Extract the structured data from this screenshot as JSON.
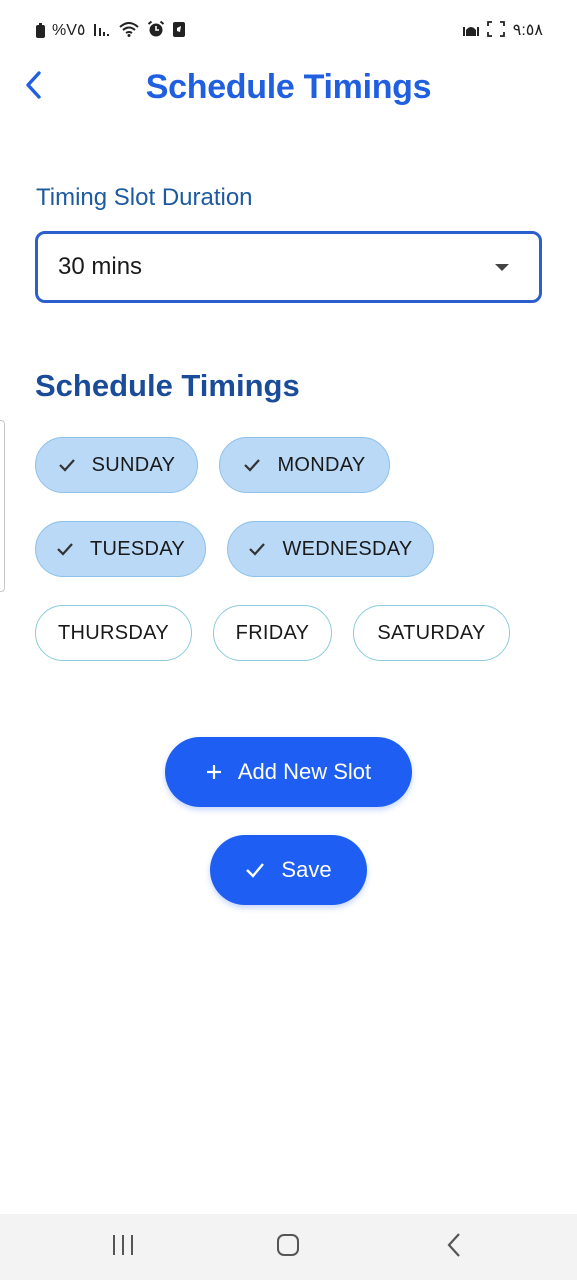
{
  "status_bar": {
    "left_text": "%V٥",
    "right_time": "٩:٥٨"
  },
  "header": {
    "title": "Schedule Timings",
    "back_icon": "chevron-left-icon"
  },
  "slot_duration": {
    "label": "Timing Slot Duration",
    "selected_value": "30 mins"
  },
  "schedule": {
    "title": "Schedule Timings",
    "days": [
      {
        "label": "SUNDAY",
        "selected": true
      },
      {
        "label": "MONDAY",
        "selected": true
      },
      {
        "label": "TUESDAY",
        "selected": true
      },
      {
        "label": "WEDNESDAY",
        "selected": true
      },
      {
        "label": "THURSDAY",
        "selected": false
      },
      {
        "label": "FRIDAY",
        "selected": false
      },
      {
        "label": "SATURDAY",
        "selected": false
      }
    ]
  },
  "actions": {
    "add_slot_label": "Add New Slot",
    "save_label": "Save"
  },
  "colors": {
    "accent": "#1e5ef3",
    "title": "#1f5fe0",
    "chip_selected_bg": "#bad9f7",
    "chip_border": "#8ccadd"
  }
}
